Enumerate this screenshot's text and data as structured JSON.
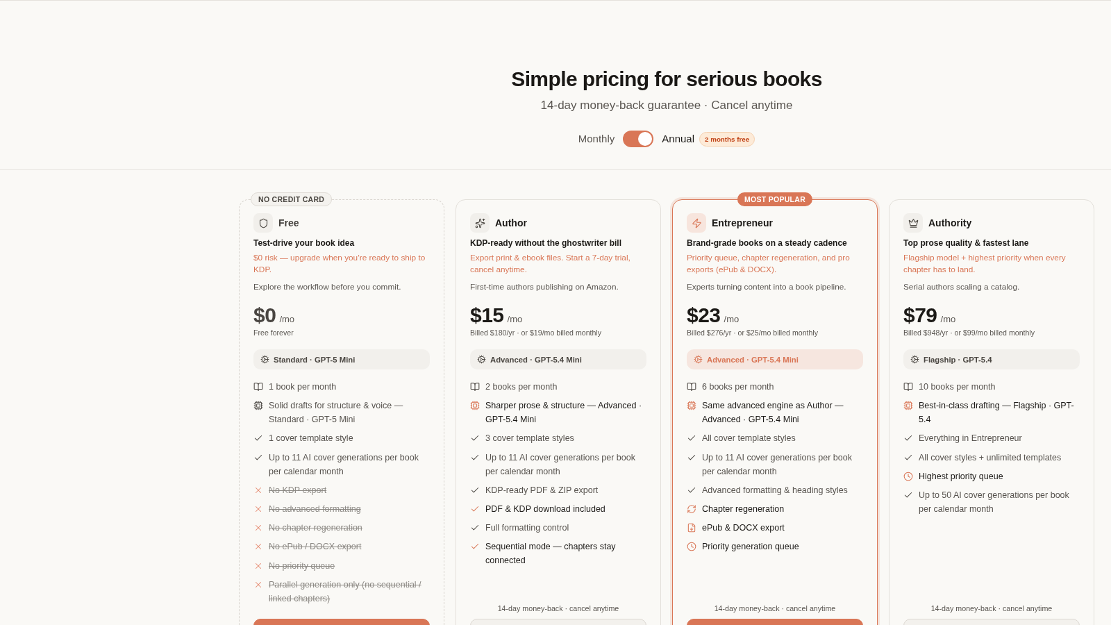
{
  "header": {
    "title": "Simple pricing for serious books",
    "subtitle": "14-day money-back guarantee · Cancel anytime"
  },
  "billing": {
    "monthly_label": "Monthly",
    "annual_label": "Annual",
    "on": true,
    "badge": "2 months free"
  },
  "plans": [
    {
      "kind": "free",
      "badge": "NO CREDIT CARD",
      "name": "Free",
      "tagline": "Test-drive your book idea",
      "pitch": "$0 risk — upgrade when you’re ready to ship to KDP.",
      "audience": "Explore the workflow before you commit.",
      "price": "$0",
      "period": "/mo",
      "billing_note": "Free forever",
      "model": "Standard · GPT-5 Mini",
      "features": [
        {
          "kind": "book",
          "text": "1 book per month",
          "highlight": false
        },
        {
          "kind": "chip",
          "text": "Solid drafts for structure & voice — Standard · GPT-5 Mini",
          "highlight": false
        },
        {
          "kind": "check",
          "text": "1 cover template style",
          "highlight": false
        },
        {
          "kind": "check",
          "text": "Up to 11 AI cover generations per book per calendar month",
          "highlight": false
        },
        {
          "kind": "cross",
          "text": "No KDP export",
          "highlight": false
        },
        {
          "kind": "cross",
          "text": "No advanced formatting",
          "highlight": false
        },
        {
          "kind": "cross",
          "text": "No chapter regeneration",
          "highlight": false
        },
        {
          "kind": "cross",
          "text": "No ePub / DOCX export",
          "highlight": false
        },
        {
          "kind": "cross",
          "text": "No priority queue",
          "highlight": false
        },
        {
          "kind": "cross",
          "text": "Parallel generation only (no sequential / linked chapters)",
          "highlight": false
        }
      ],
      "button": {
        "kind": "filled"
      }
    },
    {
      "kind": "standard",
      "name": "Author",
      "tagline": "KDP-ready without the ghostwriter bill",
      "pitch": "Export print & ebook files. Start a 7-day trial, cancel anytime.",
      "audience": "First-time authors publishing on Amazon.",
      "price": "$15",
      "period": "/mo",
      "billing_note": "Billed $180/yr · or $19/mo billed monthly",
      "model": "Advanced · GPT-5.4 Mini",
      "features": [
        {
          "kind": "book",
          "text": "2 books per month",
          "highlight": false
        },
        {
          "kind": "chip",
          "text": "Sharper prose & structure — Advanced · GPT-5.4 Mini",
          "highlight": true
        },
        {
          "kind": "check",
          "text": "3 cover template styles",
          "highlight": false
        },
        {
          "kind": "check",
          "text": "Up to 11 AI cover generations per book per calendar month",
          "highlight": false
        },
        {
          "kind": "check",
          "text": "KDP-ready PDF & ZIP export",
          "highlight": false
        },
        {
          "kind": "check",
          "text": "PDF & KDP download included",
          "highlight": true
        },
        {
          "kind": "check",
          "text": "Full formatting control",
          "highlight": false
        },
        {
          "kind": "check",
          "text": "Sequential mode — chapters stay connected",
          "highlight": true
        }
      ],
      "guarantee": "14-day money-back · cancel anytime",
      "button": {
        "kind": "outline"
      }
    },
    {
      "kind": "featured",
      "badge": "MOST POPULAR",
      "name": "Entrepreneur",
      "tagline": "Brand-grade books on a steady cadence",
      "pitch": "Priority queue, chapter regeneration, and pro exports (ePub & DOCX).",
      "audience": "Experts turning content into a book pipeline.",
      "price": "$23",
      "period": "/mo",
      "billing_note": "Billed $276/yr · or $25/mo billed monthly",
      "model": "Advanced · GPT-5.4 Mini",
      "features": [
        {
          "kind": "book",
          "text": "6 books per month",
          "highlight": false
        },
        {
          "kind": "chip",
          "text": "Same advanced engine as Author — Advanced · GPT-5.4 Mini",
          "highlight": true
        },
        {
          "kind": "check",
          "text": "All cover template styles",
          "highlight": false
        },
        {
          "kind": "check",
          "text": "Up to 11 AI cover generations per book per calendar month",
          "highlight": false
        },
        {
          "kind": "check",
          "text": "Advanced formatting & heading styles",
          "highlight": false
        },
        {
          "kind": "refresh",
          "text": "Chapter regeneration",
          "highlight": true
        },
        {
          "kind": "file",
          "text": "ePub & DOCX export",
          "highlight": true
        },
        {
          "kind": "clock",
          "text": "Priority generation queue",
          "highlight": true
        }
      ],
      "guarantee": "14-day money-back · cancel anytime",
      "button": {
        "kind": "filled"
      }
    },
    {
      "kind": "standard",
      "name": "Authority",
      "tagline": "Top prose quality & fastest lane",
      "pitch": "Flagship model + highest priority when every chapter has to land.",
      "audience": "Serial authors scaling a catalog.",
      "price": "$79",
      "period": "/mo",
      "billing_note": "Billed $948/yr · or $99/mo billed monthly",
      "model": "Flagship · GPT-5.4",
      "features": [
        {
          "kind": "book",
          "text": "10 books per month",
          "highlight": false
        },
        {
          "kind": "chip",
          "text": "Best-in-class drafting — Flagship · GPT-5.4",
          "highlight": true
        },
        {
          "kind": "check",
          "text": "Everything in Entrepreneur",
          "highlight": false
        },
        {
          "kind": "check",
          "text": "All cover styles + unlimited templates",
          "highlight": false
        },
        {
          "kind": "clock",
          "text": "Highest priority queue",
          "highlight": true
        },
        {
          "kind": "check",
          "text": "Up to 50 AI cover generations per book per calendar month",
          "highlight": false
        }
      ],
      "guarantee": "14-day money-back · cancel anytime",
      "button": {
        "kind": "outline"
      }
    }
  ]
}
